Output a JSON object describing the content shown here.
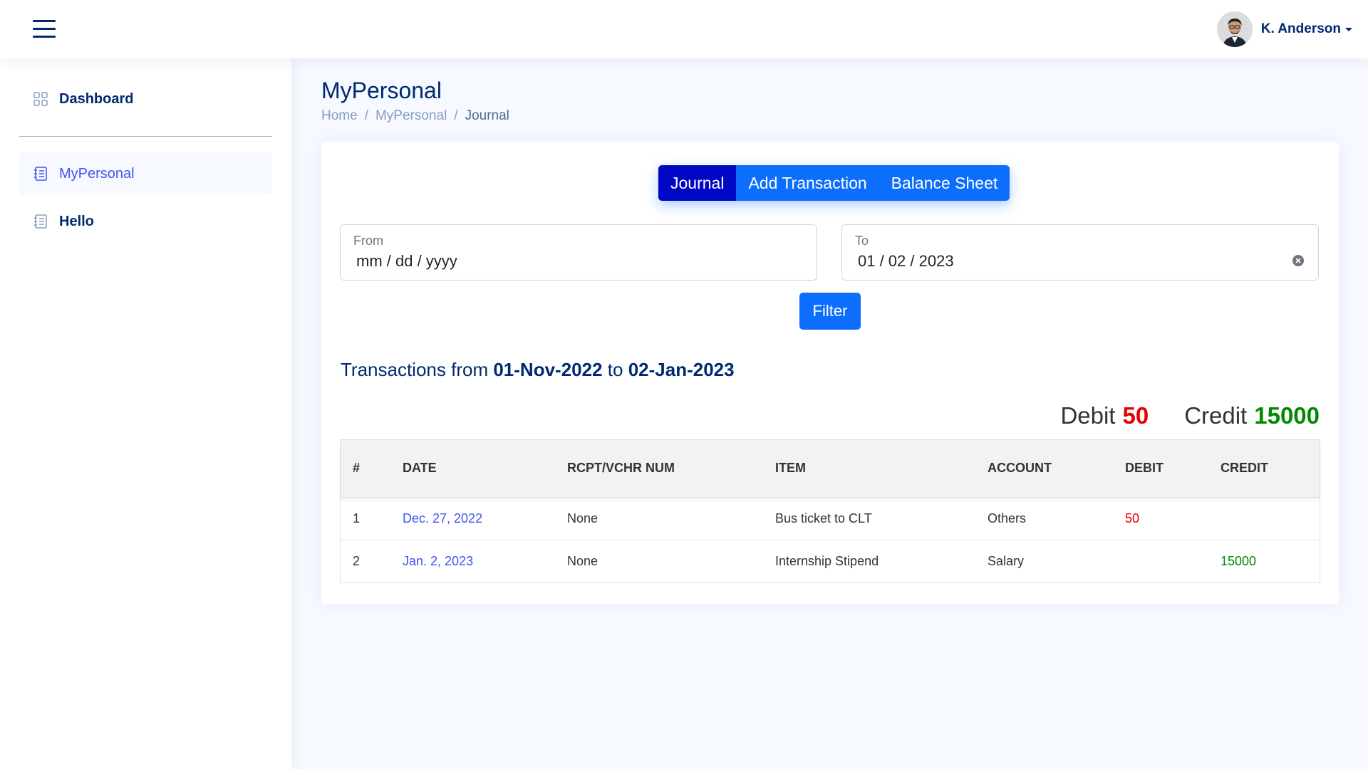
{
  "header": {
    "user_name": "K. Anderson"
  },
  "sidebar": {
    "items": [
      {
        "label": "Dashboard",
        "icon": "grid-icon"
      },
      {
        "label": "MyPersonal",
        "icon": "journal-icon"
      },
      {
        "label": "Hello",
        "icon": "journal-icon"
      }
    ]
  },
  "page": {
    "title": "MyPersonal",
    "breadcrumb": [
      "Home",
      "MyPersonal",
      "Journal"
    ],
    "breadcrumb_separator": "/"
  },
  "tabs": [
    {
      "label": "Journal",
      "active": true
    },
    {
      "label": "Add Transaction",
      "active": false
    },
    {
      "label": "Balance Sheet",
      "active": false
    }
  ],
  "filter": {
    "from_label": "From",
    "from_value": "mm / dd / yyyy",
    "to_label": "To",
    "to_value": "01 / 02 / 2023",
    "button_label": "Filter"
  },
  "summary": {
    "prefix": "Transactions from",
    "from_date": "01-Nov-2022",
    "joiner": "to",
    "to_date": "02-Jan-2023",
    "debit_label": "Debit",
    "debit_total": "50",
    "credit_label": "Credit",
    "credit_total": "15000"
  },
  "table": {
    "headers": [
      "#",
      "DATE",
      "RCPT/VCHR NUM",
      "ITEM",
      "ACCOUNT",
      "DEBIT",
      "CREDIT"
    ],
    "rows": [
      [
        "1",
        "Dec. 27, 2022",
        "None",
        "Bus ticket to CLT",
        "Others",
        "50",
        ""
      ],
      [
        "2",
        "Jan. 2, 2023",
        "None",
        "Internship Stipend",
        "Salary",
        "",
        "15000"
      ]
    ]
  },
  "colors": {
    "primary": "#0d6efd",
    "active_tab": "#0008c5",
    "navy": "#012970",
    "debit": "#e60000",
    "credit": "#008a00",
    "link": "#4154f1"
  }
}
